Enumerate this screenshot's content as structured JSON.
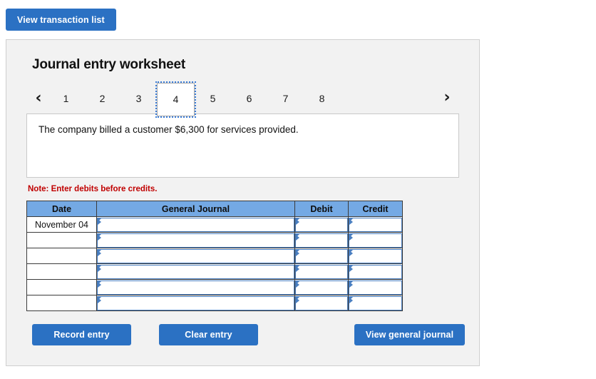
{
  "toolbar": {
    "view_transaction_list_label": "View transaction list"
  },
  "worksheet": {
    "title": "Journal entry worksheet",
    "pager": {
      "prev_icon": "‹",
      "next_icon": "›",
      "pages": [
        "1",
        "2",
        "3",
        "4",
        "5",
        "6",
        "7",
        "8"
      ],
      "active_page": "4"
    },
    "description": "The company billed a customer $6,300 for services provided.",
    "note": "Note: Enter debits before credits.",
    "table": {
      "headers": [
        "Date",
        "General Journal",
        "Debit",
        "Credit"
      ],
      "rows": [
        {
          "date": "November 04",
          "general_journal": "",
          "debit": "",
          "credit": ""
        },
        {
          "date": "",
          "general_journal": "",
          "debit": "",
          "credit": ""
        },
        {
          "date": "",
          "general_journal": "",
          "debit": "",
          "credit": ""
        },
        {
          "date": "",
          "general_journal": "",
          "debit": "",
          "credit": ""
        },
        {
          "date": "",
          "general_journal": "",
          "debit": "",
          "credit": ""
        },
        {
          "date": "",
          "general_journal": "",
          "debit": "",
          "credit": ""
        }
      ]
    },
    "actions": {
      "record_entry_label": "Record entry",
      "clear_entry_label": "Clear entry",
      "view_general_journal_label": "View general journal"
    }
  },
  "colors": {
    "button_blue": "#2b71c3",
    "table_header_blue": "#74a9e4",
    "cell_border_blue": "#4a7fc1",
    "note_red": "#c00000",
    "panel_bg": "#f2f2f2"
  }
}
